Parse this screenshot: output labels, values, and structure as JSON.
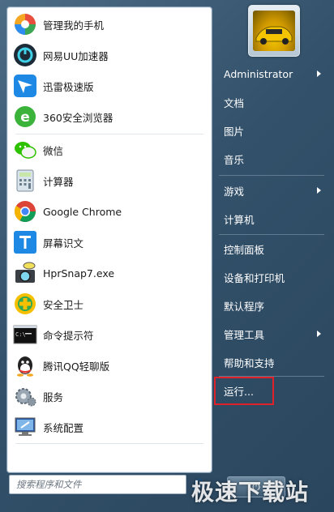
{
  "programs": [
    {
      "label": "管理我的手机",
      "icon": "phone-manager-icon"
    },
    {
      "label": "网易UU加速器",
      "icon": "uu-accelerator-icon"
    },
    {
      "label": "迅雷极速版",
      "icon": "xunlei-icon"
    },
    {
      "label": "360安全浏览器",
      "icon": "360-browser-icon"
    },
    {
      "label": "微信",
      "icon": "wechat-icon"
    },
    {
      "label": "计算器",
      "icon": "calculator-icon"
    },
    {
      "label": "Google Chrome",
      "icon": "chrome-icon"
    },
    {
      "label": "屏幕识文",
      "icon": "screen-ocr-icon"
    },
    {
      "label": "HprSnap7.exe",
      "icon": "hypersnap-icon"
    },
    {
      "label": "安全卫士",
      "icon": "security-guard-icon"
    },
    {
      "label": "命令提示符",
      "icon": "command-prompt-icon"
    },
    {
      "label": "腾讯QQ轻聊版",
      "icon": "qq-icon"
    },
    {
      "label": "服务",
      "icon": "services-icon"
    },
    {
      "label": "系统配置",
      "icon": "system-config-icon"
    }
  ],
  "search": {
    "placeholder": "搜索程序和文件"
  },
  "right_menu": [
    {
      "label": "Administrator",
      "arrow": true
    },
    {
      "label": "文档",
      "arrow": false
    },
    {
      "label": "图片",
      "arrow": false
    },
    {
      "label": "音乐",
      "arrow": false
    },
    {
      "label": "游戏",
      "arrow": true
    },
    {
      "label": "计算机",
      "arrow": false
    },
    {
      "label": "控制面板",
      "arrow": false
    },
    {
      "label": "设备和打印机",
      "arrow": false
    },
    {
      "label": "默认程序",
      "arrow": false
    },
    {
      "label": "管理工具",
      "arrow": true
    },
    {
      "label": "帮助和支持",
      "arrow": false
    },
    {
      "label": "运行...",
      "arrow": false
    }
  ],
  "watermark": "极速下载站",
  "colors": {
    "highlight": "#e0212a",
    "menu_text": "#ffffff"
  }
}
